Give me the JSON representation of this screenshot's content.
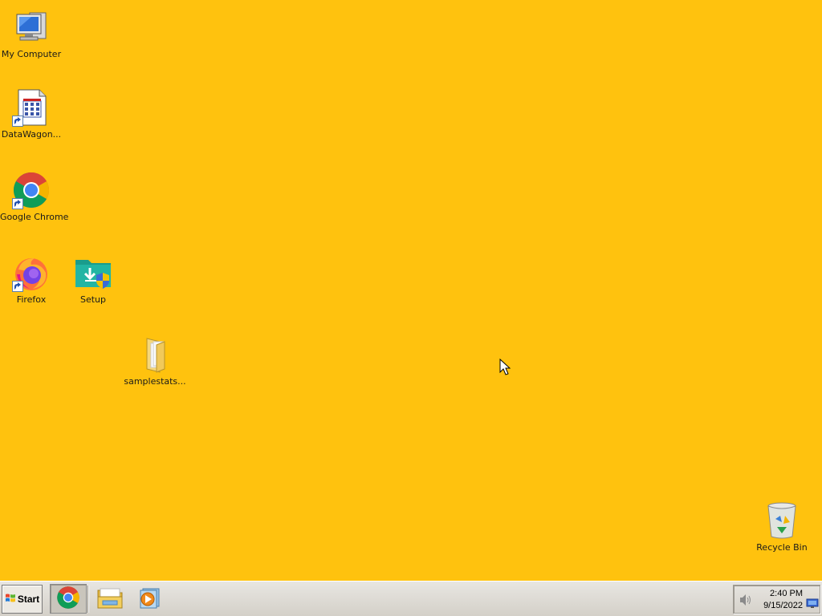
{
  "desktop": {
    "background_color": "#FFC20E",
    "icons": [
      {
        "name": "my-computer-icon",
        "label": "My Computer"
      },
      {
        "name": "datawagon-icon",
        "label": "DataWagon..."
      },
      {
        "name": "google-chrome-icon",
        "label": "Google Chrome"
      },
      {
        "name": "firefox-icon",
        "label": "Firefox"
      },
      {
        "name": "setup-icon",
        "label": "Setup"
      },
      {
        "name": "samplestats-folder-icon",
        "label": "samplestats..."
      },
      {
        "name": "recycle-bin-icon",
        "label": "Recycle Bin"
      }
    ]
  },
  "taskbar": {
    "start_label": "Start",
    "pinned": [
      "chrome-icon",
      "file-explorer-icon",
      "media-player-icon"
    ],
    "tray": {
      "time": "2:40 PM",
      "date": "9/15/2022",
      "icons": [
        "speaker-icon",
        "network-icon"
      ]
    }
  }
}
